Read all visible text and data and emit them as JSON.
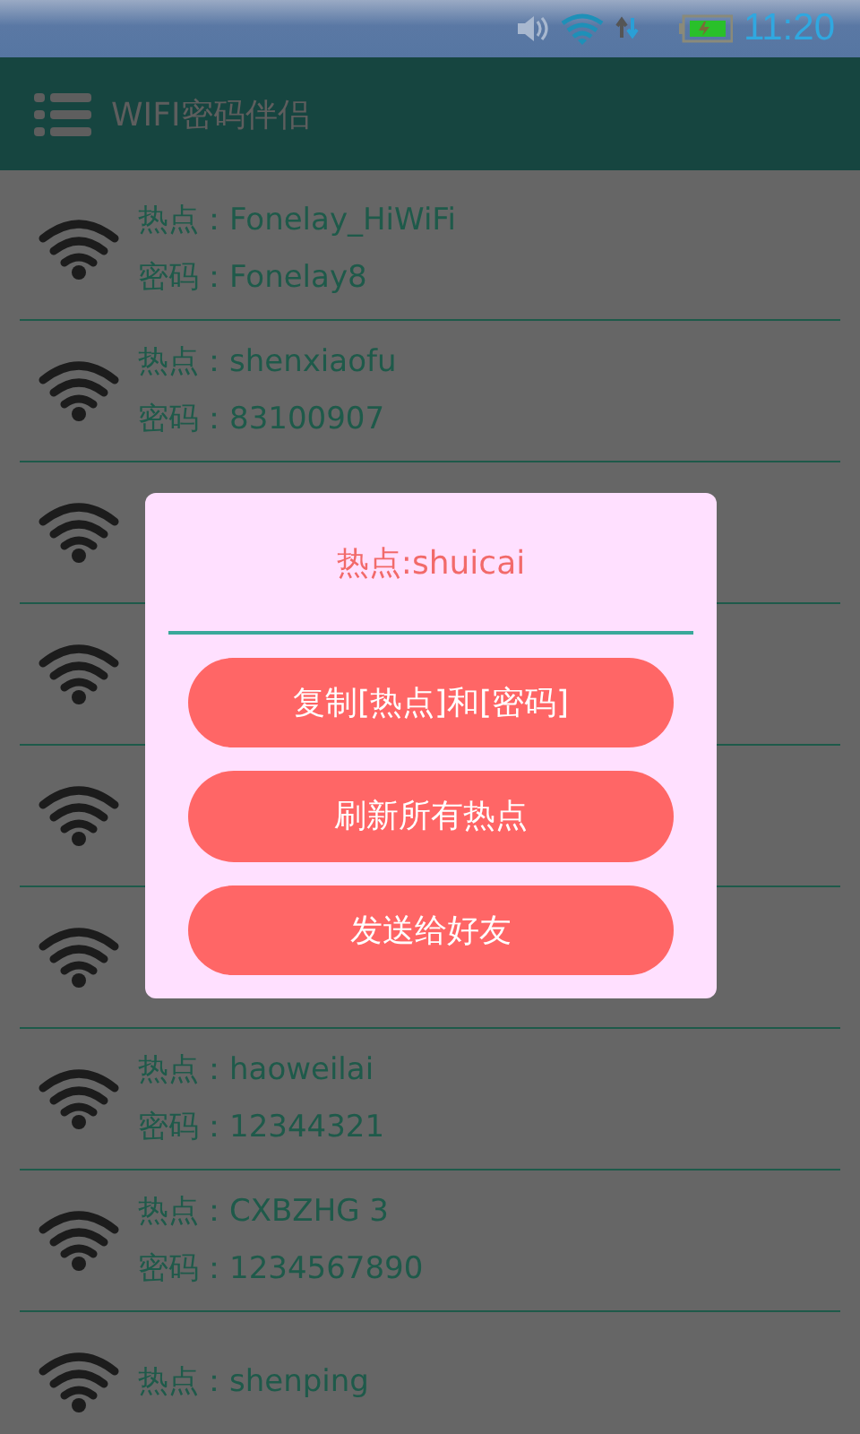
{
  "status_bar": {
    "time": "11:20"
  },
  "app_bar": {
    "title": "WIFI密码伴侣"
  },
  "networks": [
    {
      "kind": "entry",
      "hotspot_label": "热点：",
      "hotspot": "Fonelay_HiWiFi",
      "password_label": "密码：",
      "password": "Fonelay8"
    },
    {
      "kind": "entry",
      "hotspot_label": "热点：",
      "hotspot": "shenxiaofu",
      "password_label": "密码：",
      "password": "83100907"
    },
    {
      "kind": "covered"
    },
    {
      "kind": "covered"
    },
    {
      "kind": "covered"
    },
    {
      "kind": "covered"
    },
    {
      "kind": "entry",
      "hotspot_label": "热点：",
      "hotspot": "haoweilai",
      "password_label": "密码：",
      "password": "12344321"
    },
    {
      "kind": "entry",
      "hotspot_label": "热点：",
      "hotspot": "CXBZHG 3",
      "password_label": "密码：",
      "password": "1234567890"
    },
    {
      "kind": "entry",
      "hotspot_label": "热点：",
      "hotspot": "shenping"
    }
  ],
  "dialog": {
    "title": "热点:shuicai",
    "buttons": [
      "复制[热点]和[密码]",
      "刷新所有热点",
      "发送给好友"
    ]
  }
}
